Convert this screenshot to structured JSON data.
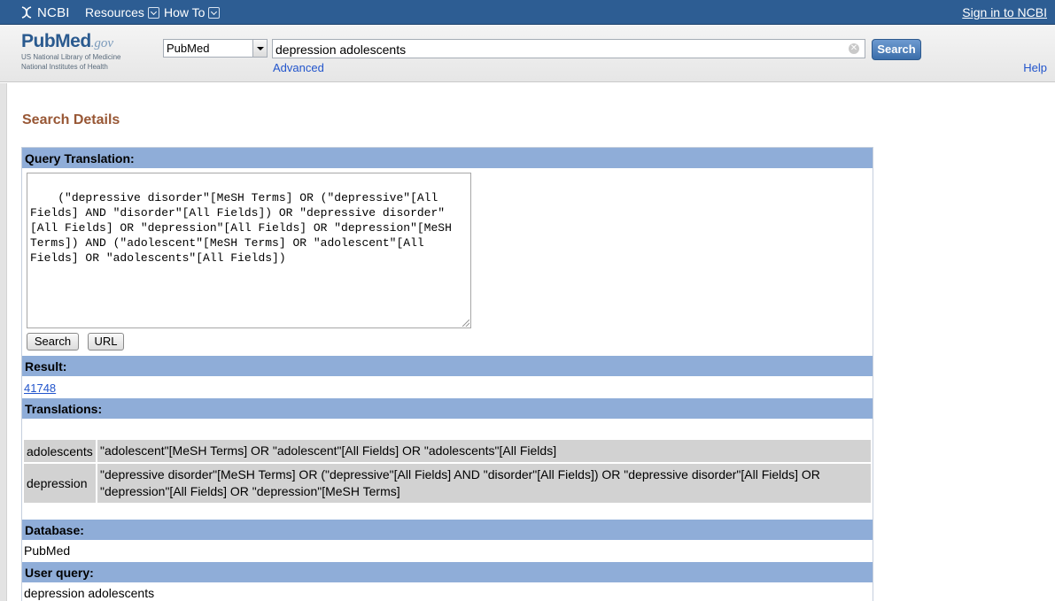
{
  "ncbi_bar": {
    "logo_text": "NCBI",
    "resources_label": "Resources",
    "howto_label": "How To",
    "signin_label": "Sign in to NCBI"
  },
  "header": {
    "logo_word_a": "Pub",
    "logo_word_b": "Med",
    "logo_gov": ".gov",
    "logo_sub1": "US National Library of Medicine",
    "logo_sub2": "National Institutes of Health",
    "database_selected": "PubMed",
    "search_term": "depression adolescents",
    "search_button": "Search",
    "advanced_label": "Advanced",
    "help_label": "Help"
  },
  "page": {
    "title": "Search Details"
  },
  "details": {
    "query_translation_heading": "Query Translation:",
    "query_translation_text": "(\"depressive disorder\"[MeSH Terms] OR (\"depressive\"[All\nFields] AND \"disorder\"[All Fields]) OR \"depressive disorder\"\n[All Fields] OR \"depression\"[All Fields] OR \"depression\"[MeSH\nTerms]) AND (\"adolescent\"[MeSH Terms] OR \"adolescent\"[All\nFields] OR \"adolescents\"[All Fields])",
    "search_button": "Search",
    "url_button": "URL",
    "result_heading": "Result:",
    "result_count": "41748",
    "translations_heading": "Translations:",
    "translations": [
      {
        "term": "adolescents",
        "translation": "\"adolescent\"[MeSH Terms] OR \"adolescent\"[All Fields] OR \"adolescents\"[All Fields]"
      },
      {
        "term": "depression",
        "translation": "\"depressive disorder\"[MeSH Terms] OR (\"depressive\"[All Fields] AND \"disorder\"[All Fields]) OR \"depressive disorder\"[All Fields] OR \"depression\"[All Fields] OR \"depression\"[MeSH Terms]"
      }
    ],
    "database_heading": "Database:",
    "database_value": "PubMed",
    "user_query_heading": "User query:",
    "user_query_value": "depression adolescents"
  },
  "colors": {
    "ncbi_bar": "#2d5d93",
    "section_header": "#8fadd8",
    "title_brown": "#985735",
    "link_blue": "#2255cc"
  }
}
